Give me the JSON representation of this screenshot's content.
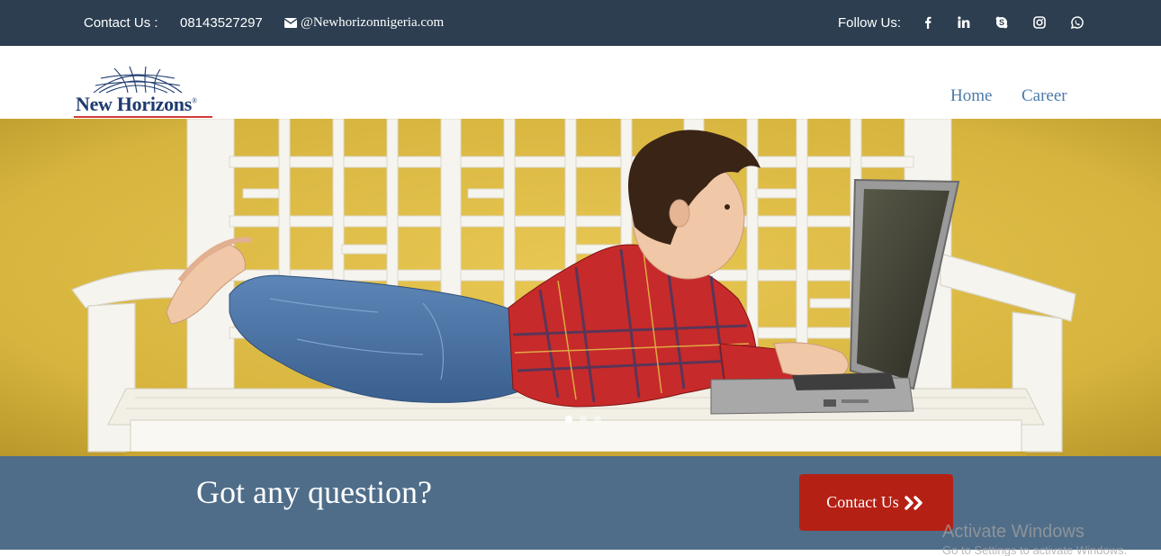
{
  "topbar": {
    "contact_label": "Contact Us :",
    "phone": "08143527297",
    "email": "@Newhorizonnigeria.com",
    "follow_label": "Follow Us:",
    "social_icons": [
      "facebook-icon",
      "linkedin-icon",
      "skype-icon",
      "instagram-icon",
      "whatsapp-icon"
    ]
  },
  "nav": {
    "logo_text": "New Horizons",
    "logo_registered": "®",
    "links": [
      {
        "label": "Home"
      },
      {
        "label": "Career"
      }
    ]
  },
  "hero": {
    "slide_count": 3,
    "active_slide": 1
  },
  "cta": {
    "title": "Got any question?",
    "button_label": "Contact Us",
    "button_icon": "double-chevron-right-icon"
  },
  "watermark": {
    "title": "Activate Windows",
    "subtitle": "Go to Settings to activate Windows."
  },
  "colors": {
    "topbar_bg": "#2c3e50",
    "nav_link": "#4a7aa8",
    "logo_blue": "#1e3a6e",
    "logo_red": "#d23a3a",
    "cta_bg": "#4f6d89",
    "cta_button": "#b52015",
    "hero_wall": "#d9b840"
  }
}
